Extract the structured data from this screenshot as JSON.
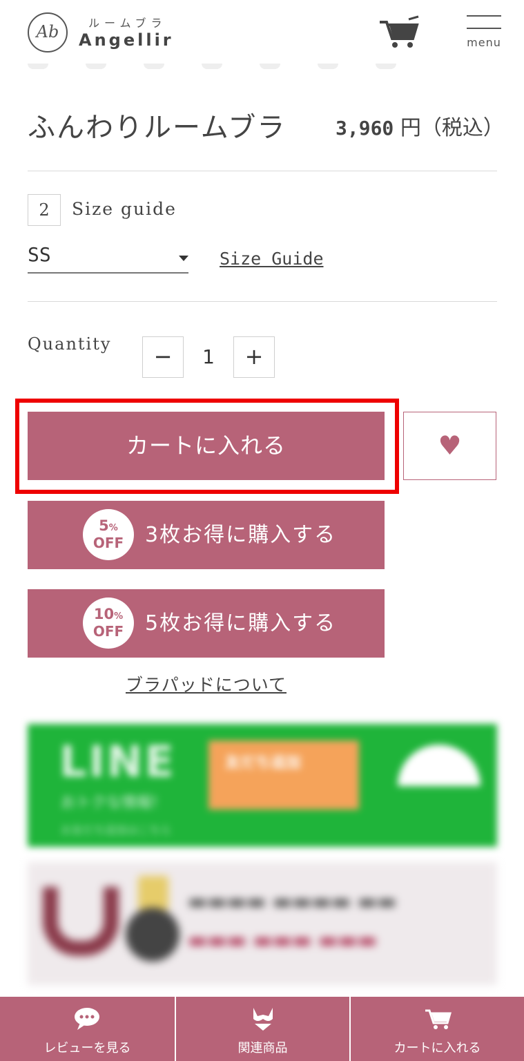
{
  "header": {
    "logo_mark": "Ab",
    "logo_subtitle": "ルームブラ",
    "logo_name": "Angellir",
    "menu_label": "menu"
  },
  "product": {
    "title": "ふんわりルームブラ",
    "price_value": "3,960",
    "price_unit": "円（税込）"
  },
  "size": {
    "count": "2",
    "guide_label": "Size guide",
    "selected": "SS",
    "guide_link": "Size Guide"
  },
  "quantity": {
    "label": "Quantity",
    "minus": "−",
    "value": "1",
    "plus": "+"
  },
  "actions": {
    "add_to_cart": "カートに入れる",
    "bundle3": {
      "pct": "5",
      "pct_sign": "%",
      "off": "OFF",
      "label": "3枚お得に購入する"
    },
    "bundle5": {
      "pct": "10",
      "pct_sign": "%",
      "off": "OFF",
      "label": "5枚お得に購入する"
    },
    "bra_pad_link": "ブラパッドについて"
  },
  "banners": {
    "line_title": "LINE",
    "line_sub": "おトクな情報!",
    "line_small": "お友だち追加はこちら",
    "line_cta": "友だち追加"
  },
  "bottom_nav": {
    "items": [
      {
        "label": "レビューを見る",
        "icon": "chat-bubble-icon"
      },
      {
        "label": "関連商品",
        "icon": "bra-icon"
      },
      {
        "label": "カートに入れる",
        "icon": "cart-icon"
      }
    ]
  },
  "colors": {
    "brand": "#b76378",
    "highlight": "#ee0000",
    "line_green": "#1fb43a"
  }
}
